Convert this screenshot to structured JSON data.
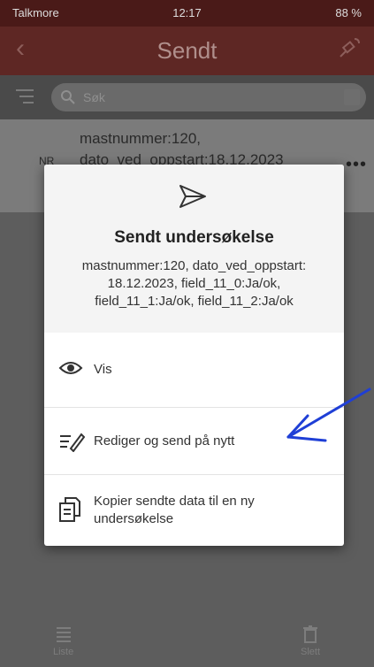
{
  "status_bar": {
    "carrier": "Talkmore",
    "time": "12:17",
    "battery": "88 %"
  },
  "nav": {
    "title": "Sendt"
  },
  "search": {
    "placeholder": "Søk"
  },
  "list": {
    "item": {
      "line1": "mastnummer:120,",
      "line2": "dato_ved_oppstart:18.12.2023",
      "nr": "NR"
    }
  },
  "tabs": [
    {
      "label": "Liste"
    },
    {
      "label": "Slett"
    }
  ],
  "modal": {
    "title": "Sendt undersøkelse",
    "body": "mastnummer:120, dato_ved_oppstart: 18.12.2023, field_11_0:Ja/ok, field_11_1:Ja/ok, field_11_2:Ja/ok",
    "options": [
      {
        "label": "Vis",
        "icon": "eye-icon"
      },
      {
        "label": "Rediger og send på nytt",
        "icon": "edit-pen-icon"
      },
      {
        "label": "Kopier sendte data til en ny undersøkelse",
        "icon": "copy-document-icon"
      }
    ]
  },
  "colors": {
    "nav_bg": "#5e2724",
    "overlay": "#5d5d5d",
    "annotation_arrow": "#1f3fd6"
  }
}
